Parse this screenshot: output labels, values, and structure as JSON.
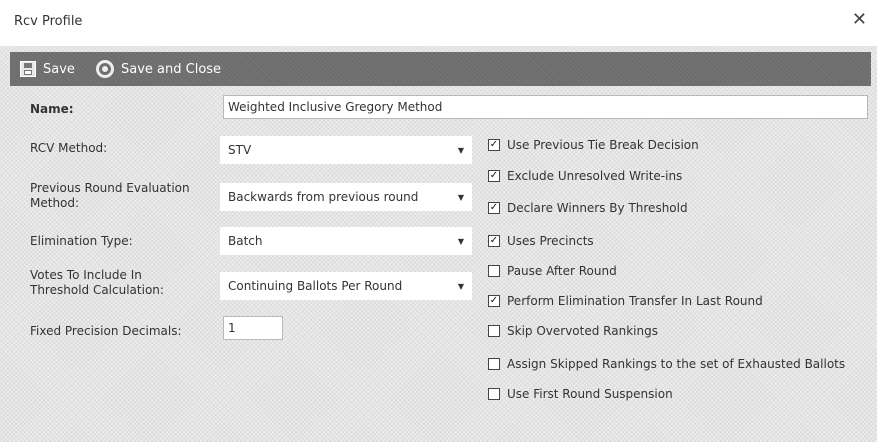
{
  "window": {
    "title": "Rcv Profile"
  },
  "toolbar": {
    "save_label": "Save",
    "save_close_label": "Save and Close"
  },
  "form": {
    "name_label": "Name:",
    "name_value": "Weighted Inclusive Gregory Method",
    "rcv_method_label": "RCV Method:",
    "rcv_method_value": "STV",
    "prev_round_label_line1": "Previous Round Evaluation",
    "prev_round_label_line2": "Method:",
    "prev_round_value": "Backwards from previous round",
    "elimination_label": "Elimination Type:",
    "elimination_value": "Batch",
    "votes_label_line1": "Votes To Include In",
    "votes_label_line2": "Threshold Calculation:",
    "votes_value": "Continuing Ballots Per Round",
    "precision_label": "Fixed Precision Decimals:",
    "precision_value": "1"
  },
  "checkboxes": [
    {
      "label": "Use Previous Tie Break Decision",
      "checked": true
    },
    {
      "label": "Exclude Unresolved Write-ins",
      "checked": true
    },
    {
      "label": "Declare Winners By Threshold",
      "checked": true
    },
    {
      "label": "Uses Precincts",
      "checked": true
    },
    {
      "label": "Pause After Round",
      "checked": false
    },
    {
      "label": "Perform Elimination Transfer In Last Round",
      "checked": true
    },
    {
      "label": "Skip Overvoted Rankings",
      "checked": false
    },
    {
      "label": "Assign Skipped Rankings to the set of Exhausted Ballots",
      "checked": false
    },
    {
      "label": "Use First Round Suspension",
      "checked": false
    }
  ],
  "check_mark": "✓"
}
